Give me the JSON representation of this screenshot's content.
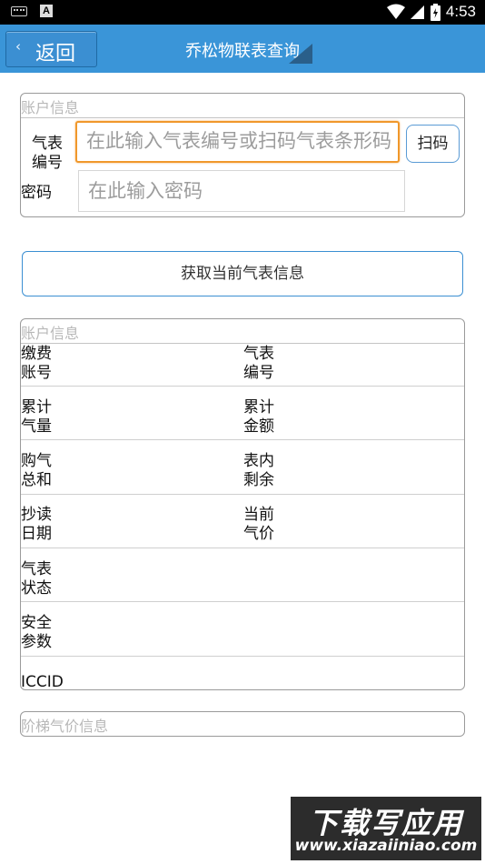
{
  "status_bar": {
    "left_icons": [
      "keyboard-icon",
      "a-notification-icon"
    ],
    "right_icons": [
      "wifi-icon",
      "signal-icon",
      "battery-icon"
    ],
    "time": "4:53"
  },
  "title_bar": {
    "back_label": "返回",
    "title": "乔松物联表查询",
    "color": "#3a95d8"
  },
  "account_form": {
    "legend": "账户信息",
    "meter_no_label_line1": "气表",
    "meter_no_label_line2": "编号",
    "meter_no_placeholder": "在此输入气表编号或扫码气表条形码",
    "scan_label": "扫码",
    "password_label": "密码",
    "password_placeholder": "在此输入密码"
  },
  "fetch_button_label": "获取当前气表信息",
  "info_panel": {
    "legend": "账户信息",
    "rows": [
      {
        "left": [
          "缴费",
          "账号"
        ],
        "right": [
          "气表",
          "编号"
        ]
      },
      {
        "left": [
          "累计",
          "气量"
        ],
        "right": [
          "累计",
          "金额"
        ]
      },
      {
        "left": [
          "购气",
          "总和"
        ],
        "right": [
          "表内",
          "剩余"
        ]
      },
      {
        "left": [
          "抄读",
          "日期"
        ],
        "right": [
          "当前",
          "气价"
        ]
      },
      {
        "left": [
          "气表",
          "状态"
        ],
        "right": [
          "",
          ""
        ]
      },
      {
        "left": [
          "安全",
          "参数"
        ],
        "right": [
          "",
          ""
        ]
      },
      {
        "left": [
          "ICCID",
          ""
        ],
        "right": [
          "",
          ""
        ]
      }
    ]
  },
  "tier_panel": {
    "legend": "阶梯气价信息"
  },
  "watermark": {
    "line1": "下载写应用",
    "line2": "www.xiazaiiniao.com"
  }
}
